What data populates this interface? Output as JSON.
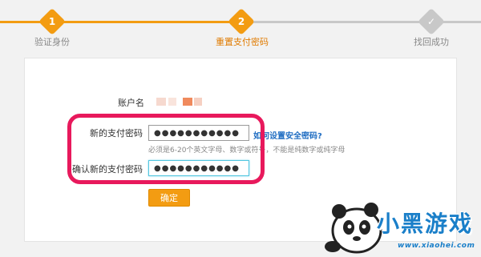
{
  "steps": [
    {
      "number": "1",
      "label": "验证身份",
      "state": "done"
    },
    {
      "number": "2",
      "label": "重置支付密码",
      "state": "active"
    },
    {
      "number": "✓",
      "label": "找回成功",
      "state": "pending"
    }
  ],
  "form": {
    "account_label": "账户名",
    "new_password_label": "新的支付密码",
    "new_password_value": "●●●●●●●●●●●",
    "help_link": "如何设置安全密码?",
    "hint": "必须是6-20个英文字母、数字或符号，不能是纯数字或纯字母",
    "confirm_password_label": "确认新的支付密码",
    "confirm_password_value": "●●●●●●●●●●●",
    "submit_label": "确定"
  },
  "watermark": {
    "brand": "小黑游戏",
    "url": "www.xiaohei.com"
  },
  "colors": {
    "accent": "#f39c12",
    "step_pending": "#c8c8c8",
    "highlight": "#e8195c",
    "link": "#1f6dc2",
    "focus": "#52c6e0"
  },
  "icons": {
    "step3": "check-icon",
    "watermark": "panda-mascot-icon"
  }
}
